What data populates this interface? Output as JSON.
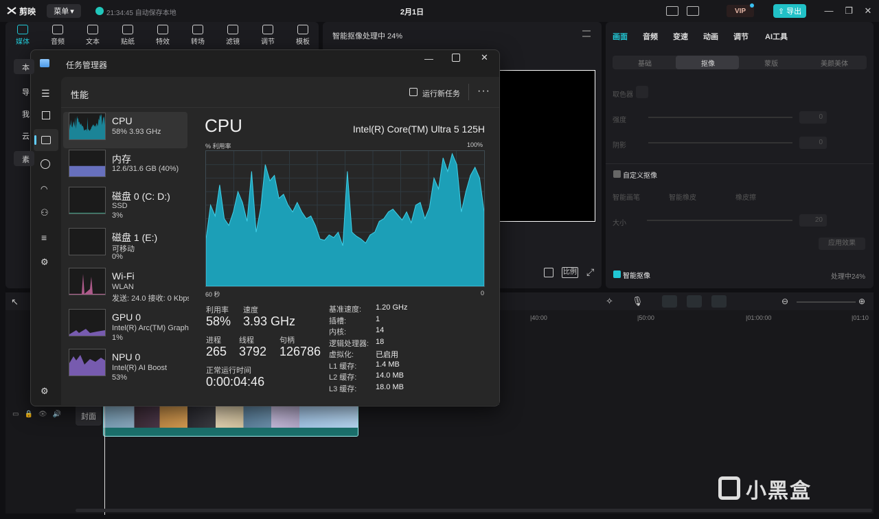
{
  "app": {
    "title": "剪映",
    "menu_label": "菜单",
    "autosave": "21:34:45 自动保存本地",
    "date": "2月1日",
    "vip": "VIP",
    "export": "导出"
  },
  "toolbar": [
    {
      "label": "媒体",
      "icon": "media-icon",
      "active": true
    },
    {
      "label": "音频",
      "icon": "audio-icon"
    },
    {
      "label": "文本",
      "icon": "text-icon"
    },
    {
      "label": "贴纸",
      "icon": "sticker-icon"
    },
    {
      "label": "特效",
      "icon": "effects-icon"
    },
    {
      "label": "转场",
      "icon": "transition-icon"
    },
    {
      "label": "滤镜",
      "icon": "filter-icon"
    },
    {
      "label": "调节",
      "icon": "adjust-icon"
    },
    {
      "label": "模板",
      "icon": "template-icon"
    }
  ],
  "media_sidebar": [
    "本",
    "导",
    "我",
    "云",
    "素"
  ],
  "preview": {
    "status": "智能抠像处理中 24%",
    "ratio_label": "比例"
  },
  "right_panel": {
    "tabs": [
      "画面",
      "音频",
      "变速",
      "动画",
      "调节",
      "AI工具"
    ],
    "segments": [
      "基础",
      "抠像",
      "蒙版",
      "美颜美体"
    ],
    "chroma_label": "取色器",
    "strength_label": "强度",
    "shadow_label": "阴影",
    "strength_value": "0",
    "shadow_value": "0",
    "custom_cutout": "自定义抠像",
    "smart_brush": "智能画笔",
    "smart_eraser": "智能橡皮",
    "eraser": "橡皮擦",
    "size_label": "大小",
    "size_value": "20",
    "apply_label": "应用效果",
    "smart_cutout": "智能抠像",
    "processing": "处理中24%"
  },
  "timeline": {
    "ruler": [
      "|40:00",
      "|50:00",
      "|01:00:00",
      "|01:10"
    ],
    "cover_label": "封面"
  },
  "task_manager": {
    "title": "任务管理器",
    "section": "性能",
    "run_new_task": "运行新任务",
    "items": [
      {
        "name": "CPU",
        "sub1": "58%  3.93 GHz",
        "sub2": ""
      },
      {
        "name": "内存",
        "sub1": "12.6/31.6 GB (40%)",
        "sub2": ""
      },
      {
        "name": "磁盘 0 (C: D:)",
        "sub1": "SSD",
        "sub2": "3%"
      },
      {
        "name": "磁盘 1 (E:)",
        "sub1": "可移动",
        "sub2": "0%"
      },
      {
        "name": "Wi-Fi",
        "sub1": "WLAN",
        "sub2": "发送: 24.0  接收: 0 Kbps"
      },
      {
        "name": "GPU 0",
        "sub1": "Intel(R) Arc(TM) Graphics",
        "sub2": "1%"
      },
      {
        "name": "NPU 0",
        "sub1": "Intel(R) AI Boost",
        "sub2": "53%"
      }
    ],
    "cpu": {
      "heading": "CPU",
      "model": "Intel(R) Core(TM) Ultra 5 125H",
      "graph_left": "% 利用率",
      "graph_right": "100%",
      "axis_left": "60 秒",
      "axis_right": "0",
      "utilization_label": "利用率",
      "utilization": "58%",
      "speed_label": "速度",
      "speed": "3.93 GHz",
      "processes_label": "进程",
      "processes": "265",
      "threads_label": "线程",
      "threads": "3792",
      "handles_label": "句柄",
      "handles": "126786",
      "uptime_label": "正常运行时间",
      "uptime": "0:00:04:46",
      "details": [
        {
          "k": "基准速度:",
          "v": "1.20 GHz"
        },
        {
          "k": "插槽:",
          "v": "1"
        },
        {
          "k": "内核:",
          "v": "14"
        },
        {
          "k": "逻辑处理器:",
          "v": "18"
        },
        {
          "k": "虚拟化:",
          "v": "已启用"
        },
        {
          "k": "L1 缓存:",
          "v": "1.4 MB"
        },
        {
          "k": "L2 缓存:",
          "v": "14.0 MB"
        },
        {
          "k": "L3 缓存:",
          "v": "18.0 MB"
        }
      ],
      "history": [
        35,
        60,
        52,
        75,
        50,
        45,
        55,
        70,
        62,
        48,
        85,
        40,
        58,
        90,
        78,
        82,
        65,
        68,
        60,
        55,
        62,
        55,
        50,
        52,
        45,
        35,
        34,
        38,
        36,
        40,
        30,
        85,
        40,
        37,
        35,
        32,
        38,
        40,
        48,
        50,
        55,
        57,
        53,
        49,
        55,
        47,
        60,
        62,
        50,
        58,
        80,
        72,
        95,
        85,
        98,
        90,
        55,
        70,
        82,
        88,
        80,
        55
      ]
    }
  },
  "watermark": "小黑盒",
  "colors": {
    "accent": "#21c7d5",
    "cpu_graph": "#1c9fb7",
    "cpu_stroke": "#3fd0e8"
  }
}
